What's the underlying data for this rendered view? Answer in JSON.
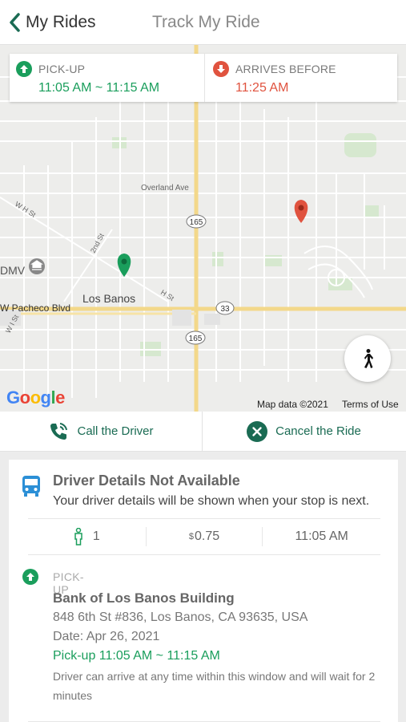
{
  "header": {
    "back_label": "My Rides",
    "title": "Track My Ride"
  },
  "timecard": {
    "pickup_label": "PICK-UP",
    "pickup_window": "11:05 AM ~ 11:15 AM",
    "arrives_label": "ARRIVES BEFORE",
    "arrives_time": "11:25 AM"
  },
  "map": {
    "streets": [
      "Overland Ave",
      "W H St",
      "2nd St",
      "H St",
      "W Pacheco Blvd",
      "W I St"
    ],
    "places": [
      "DMV",
      "Los Banos"
    ],
    "route_shields": [
      "165",
      "33",
      "165"
    ],
    "google_logo": "Google",
    "map_data": "Map data ©2021",
    "terms": "Terms of Use",
    "walk_icon": "walking-person-icon"
  },
  "actions": {
    "call_label": "Call the Driver",
    "cancel_label": "Cancel the Ride"
  },
  "driver": {
    "title": "Driver Details Not Available",
    "subtitle": "Your driver details will be shown when your stop is next."
  },
  "stats": {
    "passengers": "1",
    "currency": "$",
    "fare": "0.75",
    "time": "11:05 AM"
  },
  "pickup": {
    "label": "PICK-UP",
    "name": "Bank of Los Banos Building",
    "address": "848 6th St #836, Los Banos, CA 93635, USA",
    "date": "Date: Apr 26, 2021",
    "window": "Pick-up 11:05 AM ~ 11:15 AM",
    "note": "Driver can arrive at any time within this window and will wait for 2 minutes"
  },
  "colors": {
    "green": "#1a9e5c",
    "dark_green": "#1a6b53",
    "red": "#e0533f",
    "blue": "#2b8fd6"
  }
}
